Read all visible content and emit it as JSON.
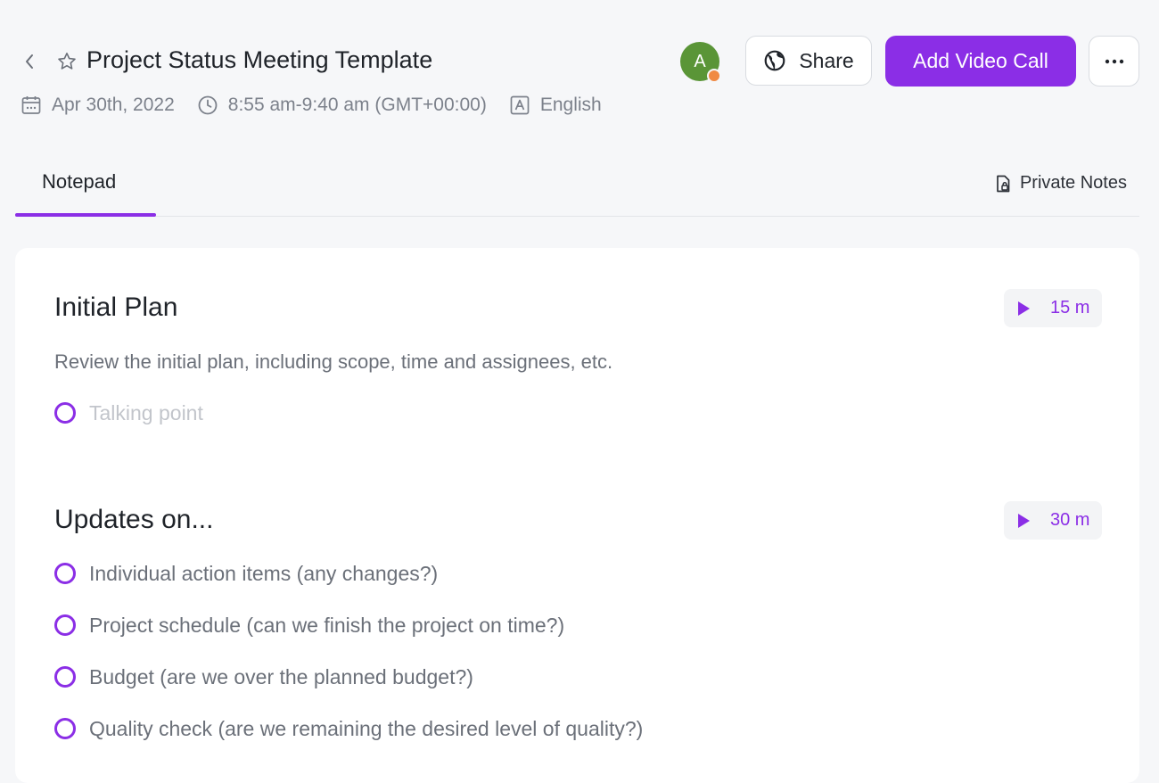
{
  "header": {
    "title": "Project Status Meeting Template",
    "date": "Apr 30th, 2022",
    "time": "8:55 am-9:40 am (GMT+00:00)",
    "language": "English",
    "avatar_initial": "A",
    "share_label": "Share",
    "video_label": "Add Video Call",
    "more_label": "···"
  },
  "tabs": {
    "notepad": "Notepad",
    "private_notes": "Private Notes"
  },
  "sections": [
    {
      "title": "Initial Plan",
      "duration": "15 m",
      "description": "Review the initial plan, including scope, time and assignees, etc.",
      "placeholder": "Talking point"
    },
    {
      "title": "Updates on...",
      "duration": "30 m",
      "items": [
        "Individual action items (any changes?)",
        "Project schedule (can we finish the project on time?)",
        "Budget (are we over the planned budget?)",
        "Quality check (are we remaining the desired level of quality?)"
      ]
    }
  ],
  "colors": {
    "accent": "#8b2ee6",
    "avatar": "#5a9537",
    "presence": "#f08a43",
    "background": "#f6f7f9"
  }
}
